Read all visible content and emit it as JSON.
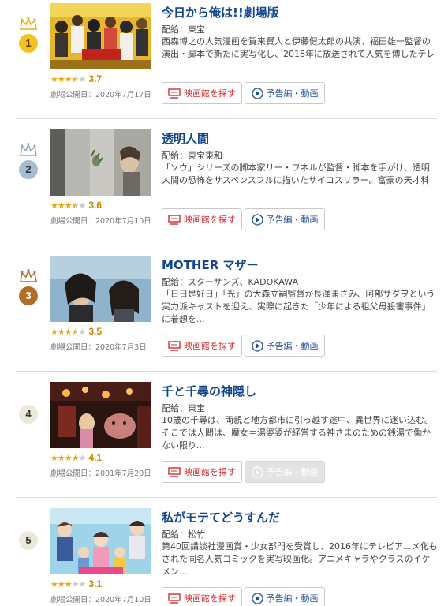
{
  "movies": [
    {
      "rank": "1",
      "title": "今日から俺は!!劇場版",
      "distributor": "配給：東宝",
      "description": "西森博之の人気漫画を賀来賢人と伊藤健太郎の共演、福田雄一監督の演出・脚本で新たに実写化し、2018年に放送されて人気を博したテレビドラ...",
      "score": "3.7",
      "stars": 3.5,
      "release": "劇場公開日：2020年7月17日",
      "theater_label": "映画館を探す",
      "trailer_label": "予告編・動画",
      "trailer_enabled": true,
      "badge_color": "#f3c31d"
    },
    {
      "rank": "2",
      "title": "透明人間",
      "distributor": "配給：東宝東和",
      "description": "「ソウ」シリーズの脚本家リー・ワネルが監督・脚本を手がけ、透明人間の恐怖をサスペンスフルに描いたサイコスリラー。富豪の天才科学者エイド...",
      "score": "3.6",
      "stars": 3.5,
      "release": "劇場公開日：2020年7月10日",
      "theater_label": "映画館を探す",
      "trailer_label": "予告編・動画",
      "trailer_enabled": true,
      "badge_color": "#a9bccd"
    },
    {
      "rank": "3",
      "title": "MOTHER マザー",
      "distributor": "配給：スターサンズ、KADOKAWA",
      "description": "「日日是好日」「光」の大森立嗣監督が長澤まさみ、阿部サダヲという実力派キャストを迎え、実際に起きた「少年による祖父母殺害事件」に着想を...",
      "score": "3.5",
      "stars": 3.5,
      "release": "劇場公開日：2020年7月3日",
      "theater_label": "映画館を探す",
      "trailer_label": "予告編・動画",
      "trailer_enabled": true,
      "badge_color": "#b26d2c"
    },
    {
      "rank": "4",
      "title": "千と千尋の神隠し",
      "distributor": "配給：東宝",
      "description": "10歳の千尋は、両親と地方都市に引っ越す途中、異世界に迷い込む。そこでは人間は、魔女＝湯婆婆が経営する神さまのための銭湯で働かない限り...",
      "score": "4.1",
      "stars": 4,
      "release": "劇場公開日：2001年7月20日",
      "theater_label": "映画館を探す",
      "trailer_label": "予告編・動画",
      "trailer_enabled": false,
      "badge_color": "#ece9dc"
    },
    {
      "rank": "5",
      "title": "私がモテてどうすんだ",
      "distributor": "配給：松竹",
      "description": "第40回講談社漫画賞・少女部門を受賞し、2016年にテレビアニメ化もされた同名人気コミックを実写映画化。アニメキャラやクラスのイケメン...",
      "score": "3.1",
      "stars": 3,
      "release": "劇場公開日：2020年7月10日",
      "theater_label": "映画館を探す",
      "trailer_label": "予告編・動画",
      "trailer_enabled": true,
      "badge_color": "#ece9dc"
    }
  ],
  "colors": {
    "title_link": "#12458e",
    "theater_button_text": "#d12e2e",
    "trailer_button_text": "#1f4f9a",
    "star": "#f0a400",
    "score": "#c98a00"
  }
}
